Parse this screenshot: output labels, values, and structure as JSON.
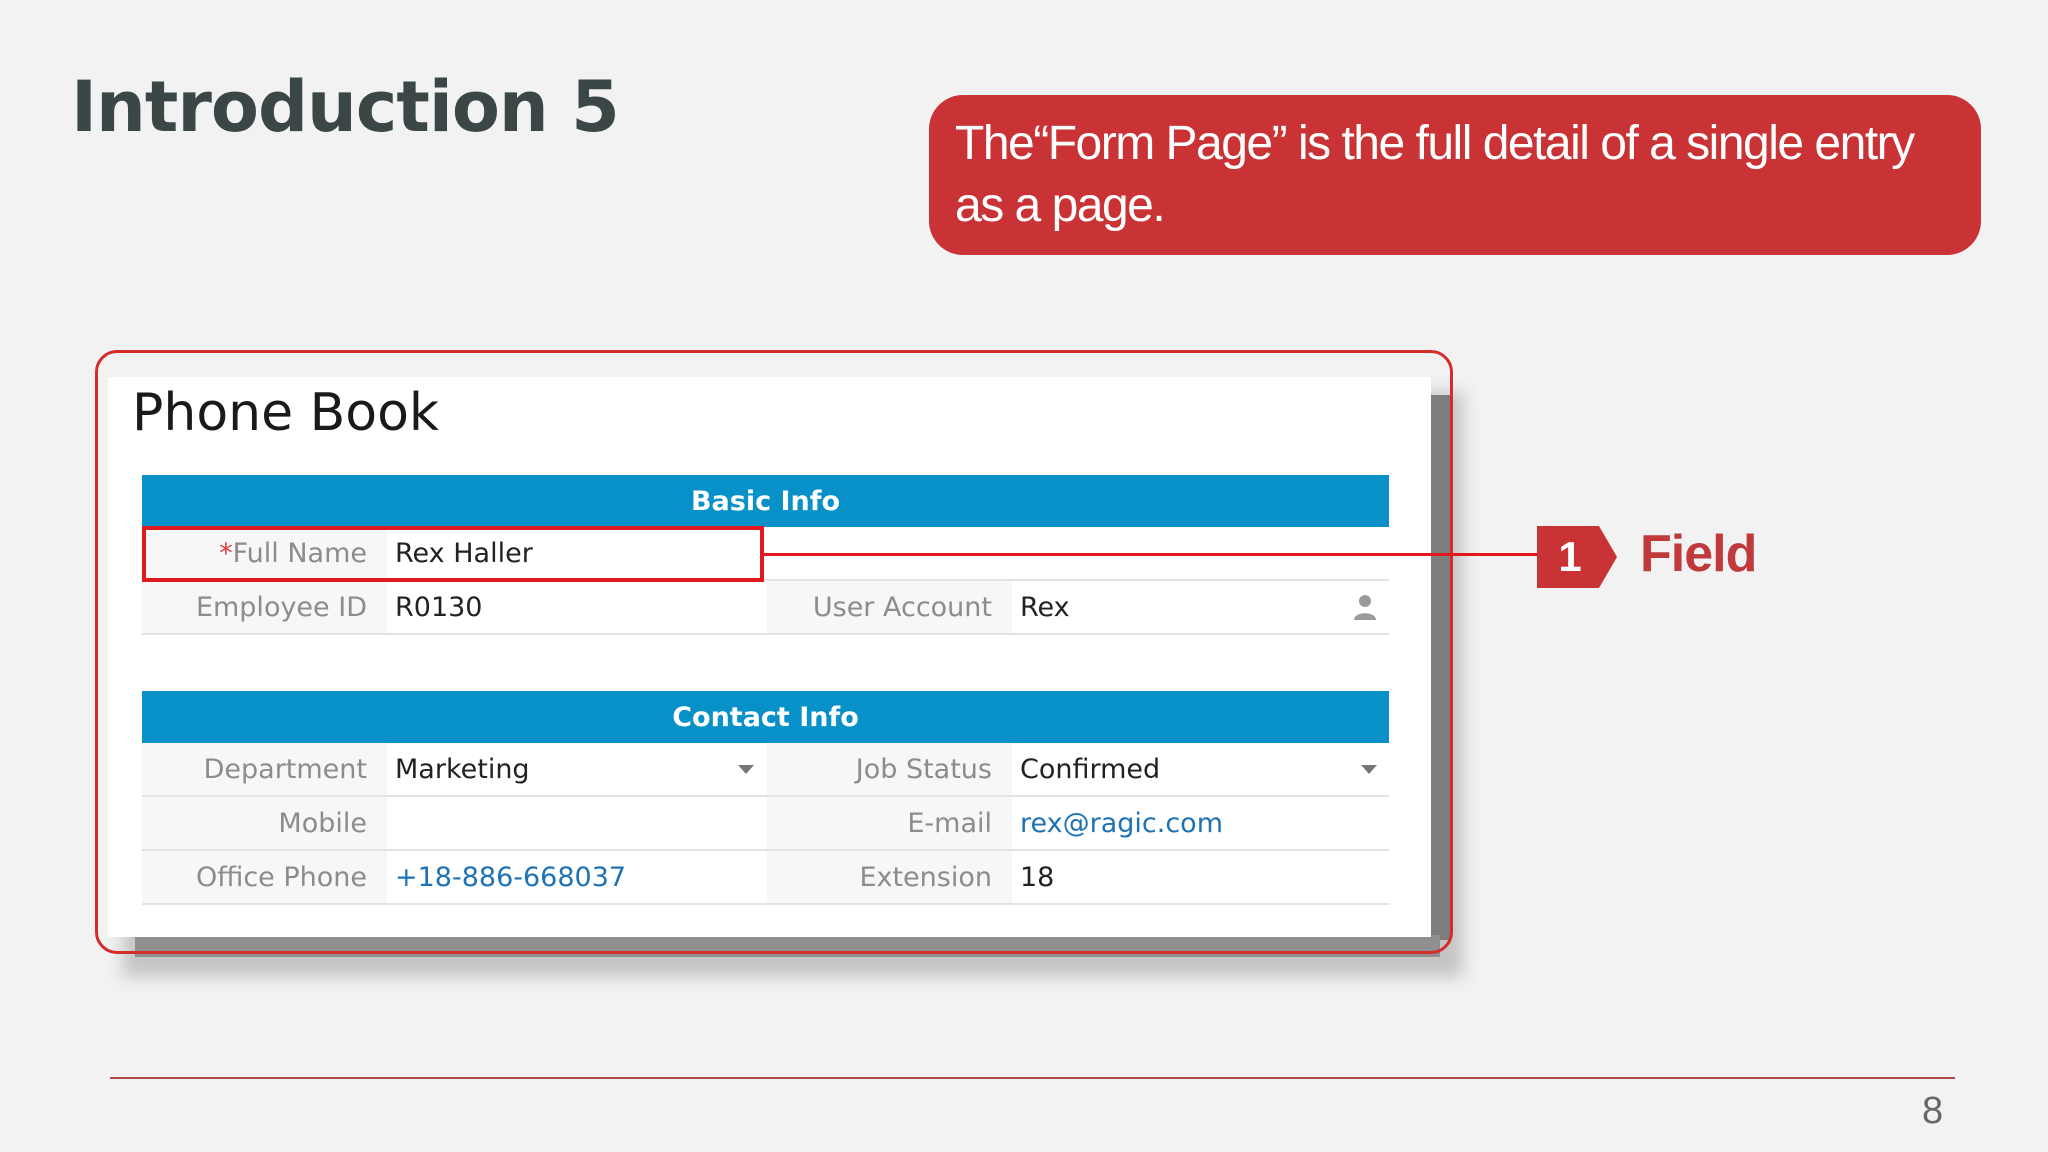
{
  "slide": {
    "title": "Introduction 5",
    "callout": "The“Form Page” is the full detail of a single entry as a page.",
    "annotation_number": "1",
    "annotation_label": "Field",
    "page_number": "8"
  },
  "form": {
    "title": "Phone Book",
    "sections": {
      "basic": "Basic Info",
      "contact": "Contact Info"
    },
    "fields": {
      "full_name": {
        "required_mark": "*",
        "label": "Full Name",
        "value": "Rex Haller"
      },
      "employee_id": {
        "label": "Employee ID",
        "value": "R0130"
      },
      "user_account": {
        "label": "User Account",
        "value": "Rex"
      },
      "department": {
        "label": "Department",
        "value": "Marketing"
      },
      "job_status": {
        "label": "Job Status",
        "value": "Confirmed"
      },
      "mobile": {
        "label": "Mobile",
        "value": ""
      },
      "email": {
        "label": "E-mail",
        "value": "rex@ragic.com"
      },
      "office_phone": {
        "label": "Office Phone",
        "value": "+18-886-668037"
      },
      "extension": {
        "label": "Extension",
        "value": "18"
      }
    }
  },
  "colors": {
    "accent_red": "#c93335",
    "header_blue": "#0891c9",
    "link_blue": "#1f73b5"
  },
  "icons": [
    "user-icon",
    "chevron-down-icon"
  ]
}
